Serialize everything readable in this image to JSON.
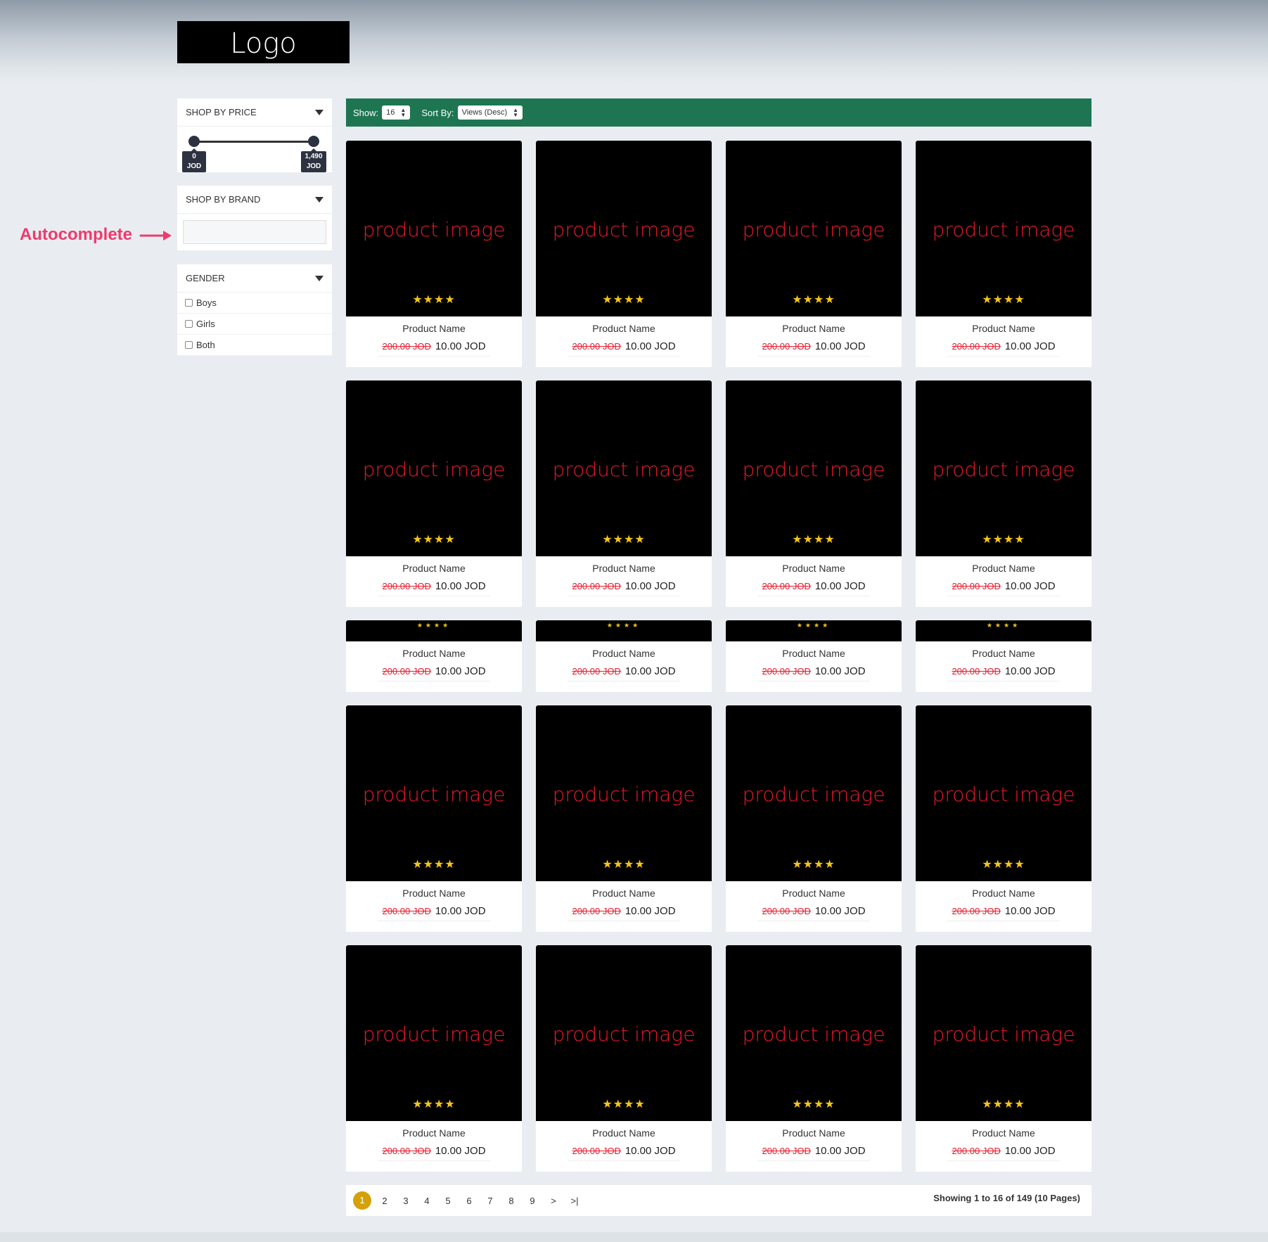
{
  "logo": "Logo",
  "annotation": "Autocomplete",
  "sidebar": {
    "price": {
      "title": "SHOP BY PRICE",
      "min_label": "0",
      "max_label": "1,490",
      "currency": "JOD",
      "range_min_value": 0,
      "range_max_value": 1490
    },
    "brand": {
      "title": "SHOP BY BRAND",
      "input_value": ""
    },
    "gender": {
      "title": "GENDER",
      "options": [
        {
          "label": "Boys",
          "checked": false
        },
        {
          "label": "Girls",
          "checked": false
        },
        {
          "label": "Both",
          "checked": false
        }
      ]
    }
  },
  "toolbar": {
    "show_label": "Show:",
    "show_value": "16",
    "sort_label": "Sort By:",
    "sort_value": "Views (Desc)"
  },
  "product": {
    "image_text": "product image",
    "stars": "★★★★",
    "name": "Product Name",
    "old_price": "200.00 JOD",
    "new_price": "10.00 JOD",
    "rating": 4
  },
  "pagination": {
    "pages": [
      "1",
      "2",
      "3",
      "4",
      "5",
      "6",
      "7",
      "8",
      "9",
      ">",
      ">|"
    ],
    "active": "1",
    "summary": "Showing 1 to 16 of 149 (10 Pages)"
  },
  "colors": {
    "toolbar": "#1e7552",
    "accent_page": "#d4a10a",
    "price_old": "#e8192c",
    "stars": "#f5c518",
    "annotation": "#ee3b6d"
  }
}
